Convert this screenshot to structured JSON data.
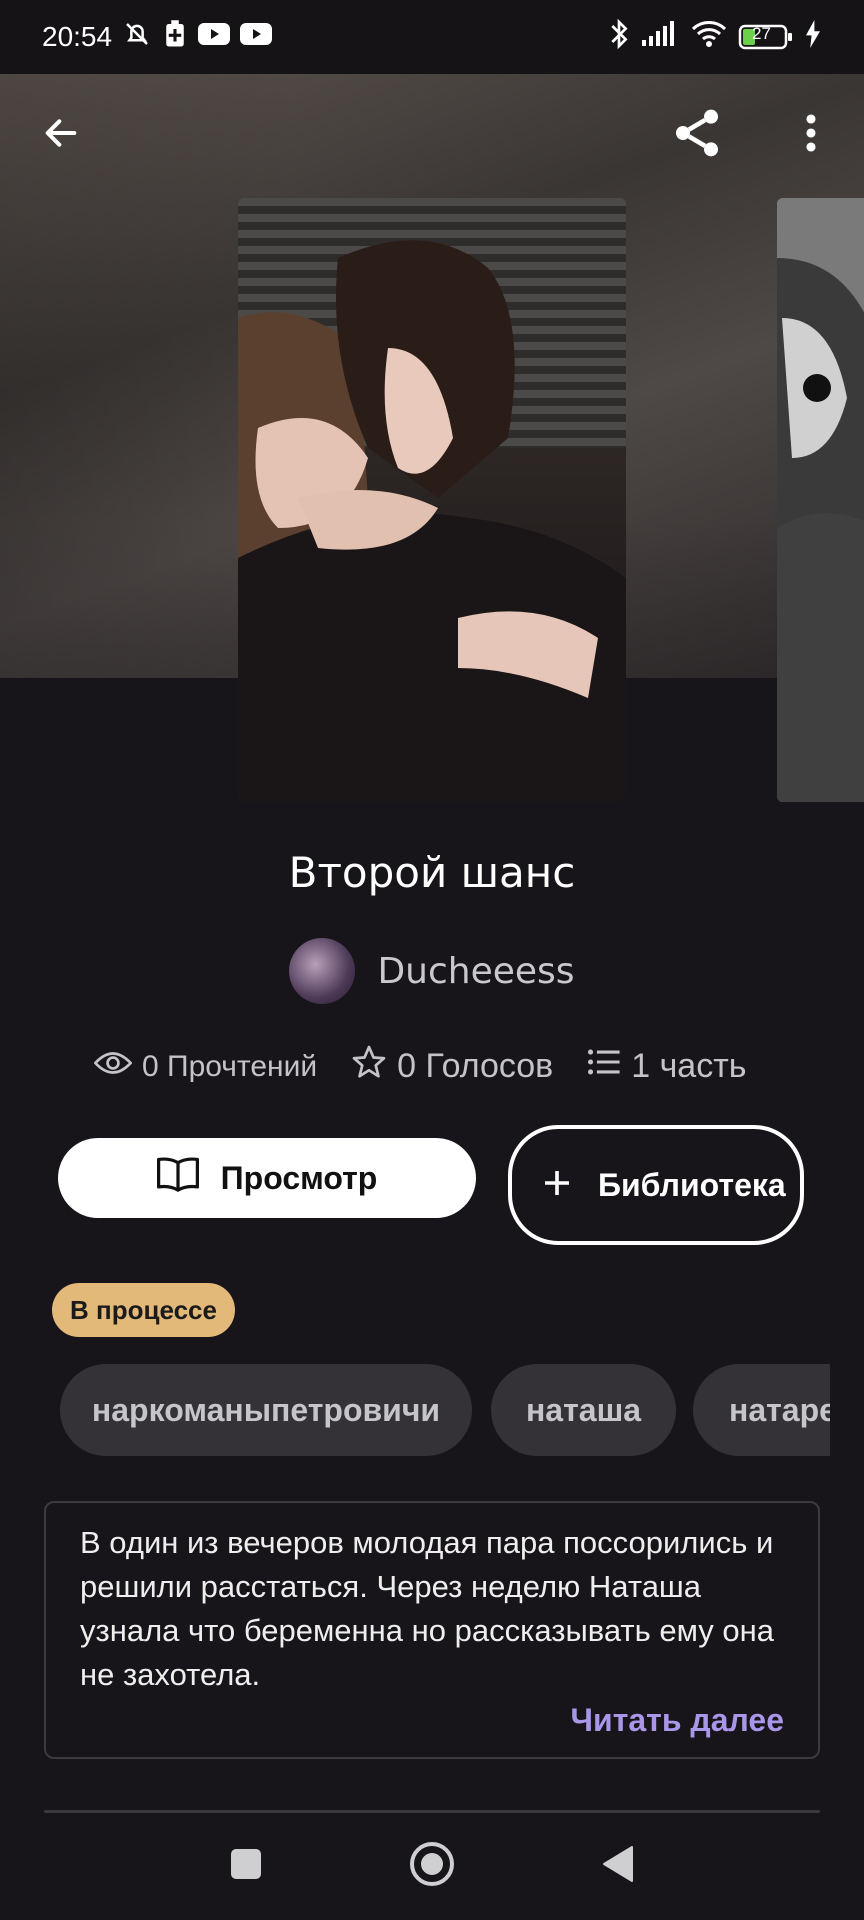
{
  "status_bar": {
    "time": "20:54",
    "battery": "27"
  },
  "story": {
    "title": "Второй шанс",
    "author": "Ducheeess",
    "stats": {
      "reads": "0 Прочтений",
      "votes": "0 Голосов",
      "parts": "1 часть"
    },
    "status": "В процессе",
    "tags": [
      "наркоманыпетровичи",
      "наташа",
      "натаре"
    ],
    "description": "В один из вечеров молодая пара поссорились и решили расстаться. Через неделю Наташа узнала что беременна но рассказывать ему она не захотела.",
    "read_more": "Читать далее"
  },
  "actions": {
    "view_label": "Просмотр",
    "library_label": "Библиотека"
  },
  "icons": {
    "back": "back-arrow-icon",
    "share": "share-icon",
    "more": "more-vertical-icon",
    "reads": "eye-icon",
    "votes": "star-icon",
    "parts": "list-icon",
    "view": "book-icon",
    "library": "plus-icon",
    "nav_recents": "square-icon",
    "nav_home": "circle-icon",
    "nav_back": "triangle-back-icon"
  },
  "colors": {
    "background": "#17151a",
    "status_badge": "#e3b979",
    "read_more": "#a996e8",
    "tag_bg": "#343236"
  }
}
